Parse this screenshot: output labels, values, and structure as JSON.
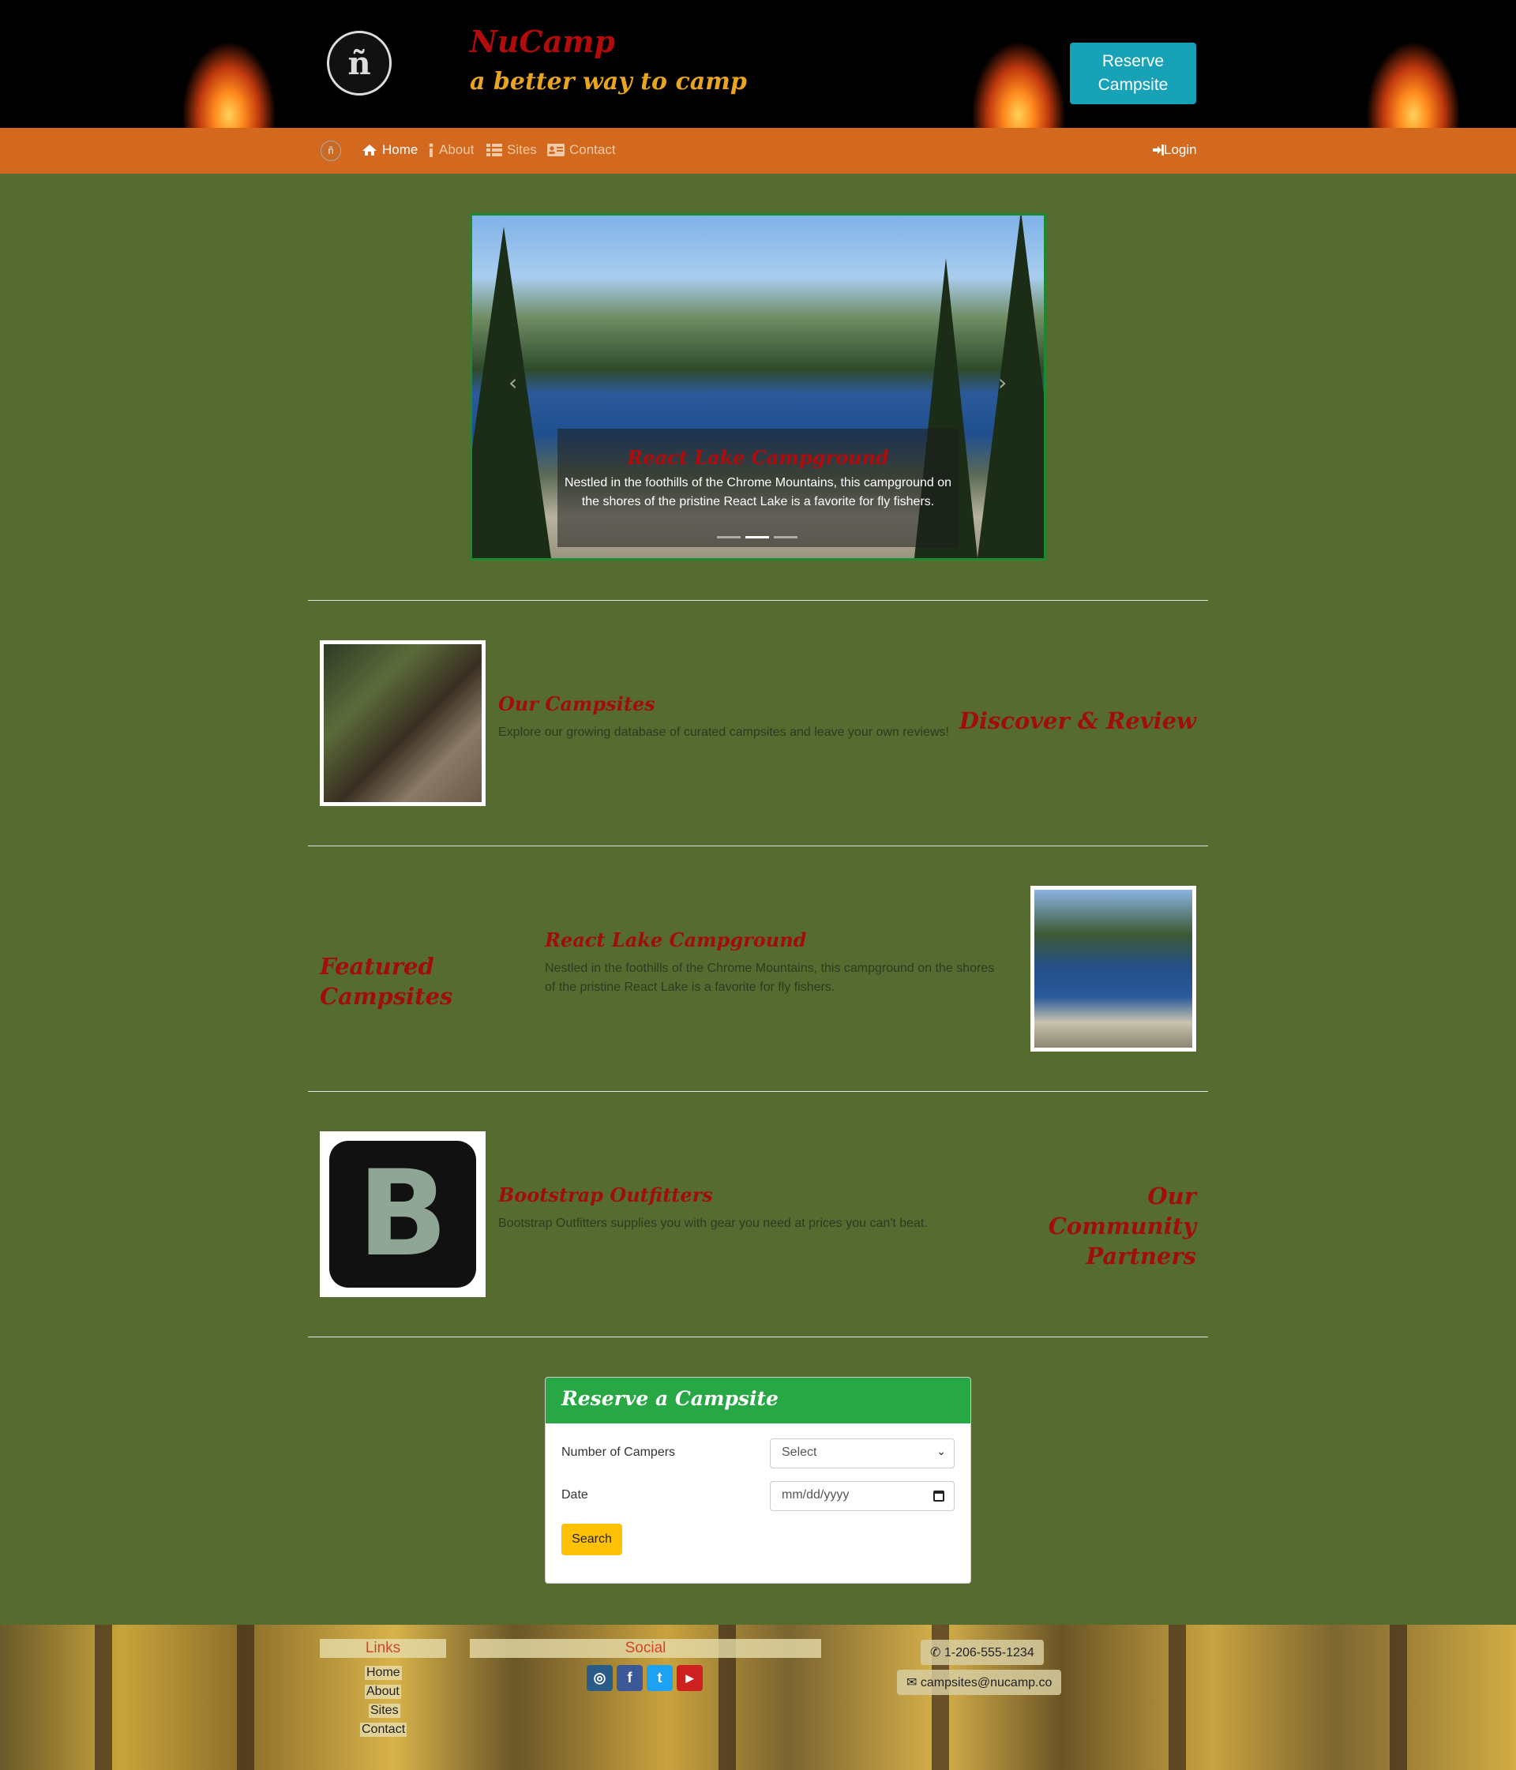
{
  "header": {
    "title": "NuCamp",
    "subtitle": "a better way to camp",
    "reserve_button": "Reserve Campsite"
  },
  "nav": {
    "items": [
      {
        "label": "Home",
        "icon": "home-icon",
        "active": true
      },
      {
        "label": "About",
        "icon": "info-icon",
        "active": false
      },
      {
        "label": "Sites",
        "icon": "list-icon",
        "active": false
      },
      {
        "label": "Contact",
        "icon": "address-card-icon",
        "active": false
      }
    ],
    "login": "Login"
  },
  "carousel": {
    "caption_title": "React Lake Campground",
    "caption_text": "Nestled in the foothills of the Chrome Mountains, this campground on the shores of the pristine React Lake is a favorite for fly fishers.",
    "slide_count": 3,
    "active_slide": 2
  },
  "media": {
    "campsites": {
      "title": "Our Campsites",
      "text": "Explore our growing database of curated campsites and leave your own reviews!",
      "side_heading": "Discover & Review"
    },
    "featured": {
      "side_heading": "Featured Campsites",
      "title": "React Lake Campground",
      "text": "Nestled in the foothills of the Chrome Mountains, this campground on the shores of the pristine React Lake is a favorite for fly fishers."
    },
    "partners": {
      "logo_letter": "B",
      "title": "Bootstrap Outfitters",
      "text": "Bootstrap Outfitters supplies you with gear you need at prices you can't beat.",
      "side_heading": "Our Community Partners"
    }
  },
  "reserve_form": {
    "title": "Reserve a Campsite",
    "campers_label": "Number of Campers",
    "campers_value": "Select",
    "date_label": "Date",
    "date_placeholder": "mm/dd/yyyy",
    "search_button": "Search"
  },
  "footer": {
    "links_heading": "Links",
    "links": [
      "Home",
      "About",
      "Sites",
      "Contact"
    ],
    "social_heading": "Social",
    "social": [
      "instagram-icon",
      "facebook-icon",
      "twitter-icon",
      "youtube-icon"
    ],
    "phone": "1-206-555-1234",
    "email": "campsites@nucamp.co"
  },
  "colors": {
    "page_bg": "#566b30",
    "nav_bg": "#d2691e",
    "brand_red": "#b10b0b",
    "brand_gold": "#e8a51f",
    "reserve_btn": "#17a2b8",
    "card_header": "#28a745",
    "search_btn": "#ffc107"
  }
}
